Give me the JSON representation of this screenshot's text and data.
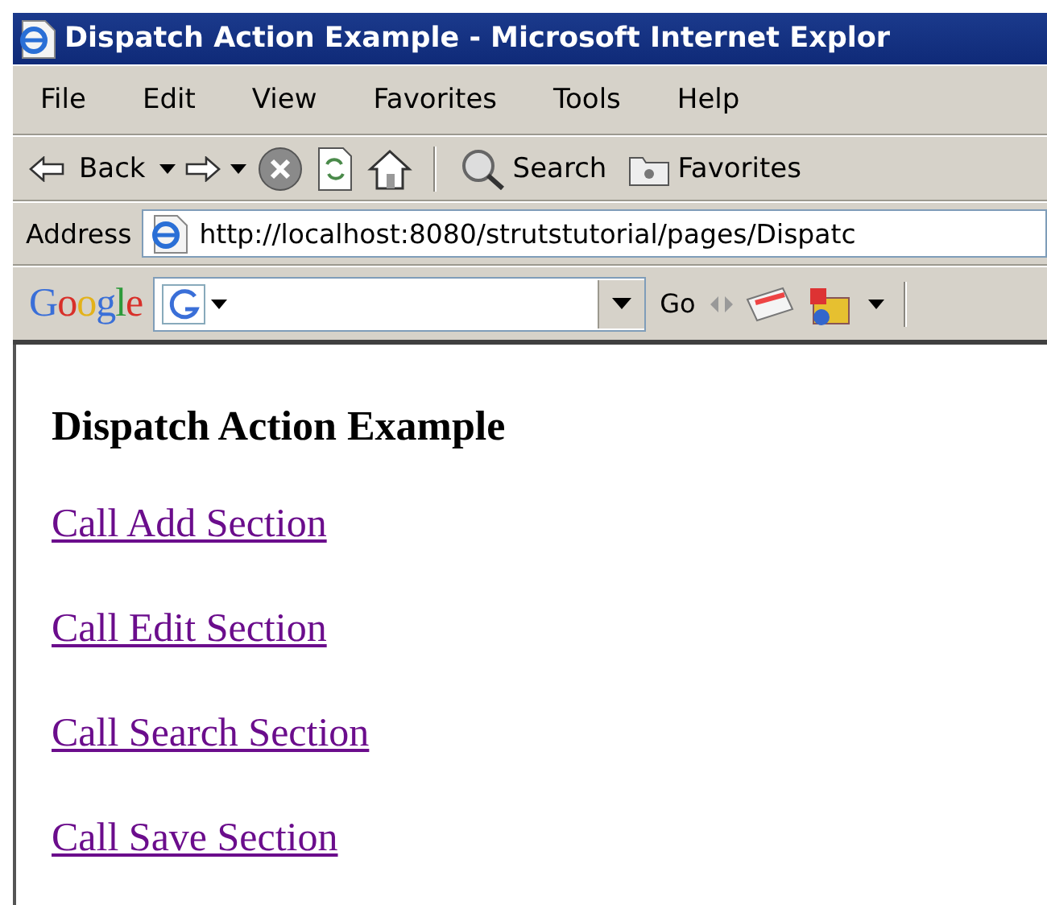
{
  "window": {
    "title": "Dispatch Action Example - Microsoft Internet Explor"
  },
  "menu": [
    "File",
    "Edit",
    "View",
    "Favorites",
    "Tools",
    "Help"
  ],
  "toolbar": {
    "back": "Back",
    "search": "Search",
    "favorites": "Favorites"
  },
  "address": {
    "label": "Address",
    "value": "http://localhost:8080/strutstutorial/pages/Dispatc"
  },
  "google_bar": {
    "logo": "Google",
    "go": "Go"
  },
  "page": {
    "heading": "Dispatch Action Example",
    "links": [
      "Call Add Section",
      "Call Edit Section",
      "Call Search Section",
      "Call Save Section"
    ]
  }
}
